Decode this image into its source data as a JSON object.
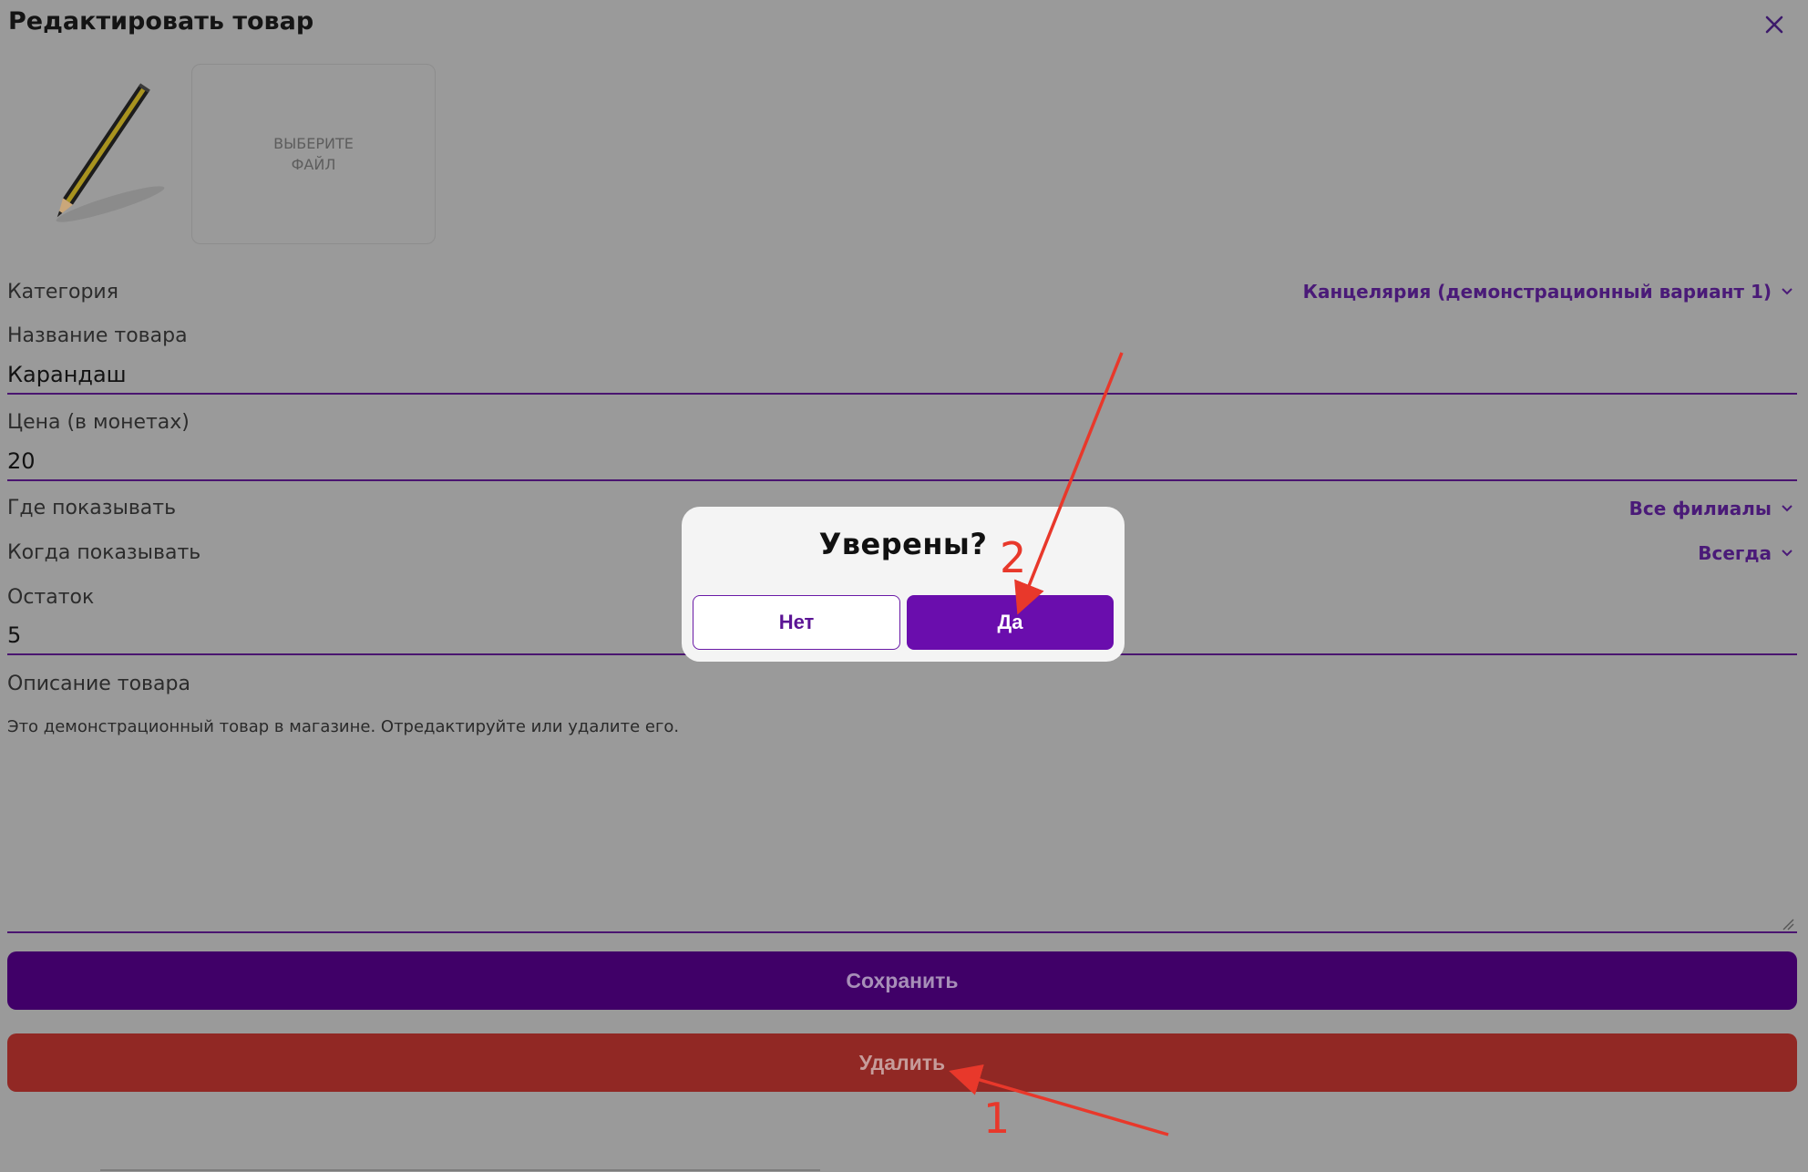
{
  "header": {
    "title": "Редактировать товар"
  },
  "image_upload": {
    "label": "ВЫБЕРИТЕ ФАЙЛ"
  },
  "form": {
    "category": {
      "label": "Категория",
      "value": "Канцелярия (демонстрационный вариант 1)"
    },
    "name": {
      "label": "Название товара",
      "value": "Карандаш"
    },
    "price": {
      "label": "Цена (в монетах)",
      "value": "20"
    },
    "where": {
      "label": "Где показывать",
      "value": "Все филиалы"
    },
    "when": {
      "label": "Когда показывать",
      "value": "Всегда"
    },
    "stock": {
      "label": "Остаток",
      "value": "5"
    },
    "description": {
      "label": "Описание товара",
      "value": "Это демонстрационный товар в магазине. Отредактируйте или удалите его."
    }
  },
  "actions": {
    "save_label": "Сохранить",
    "delete_label": "Удалить"
  },
  "confirm_dialog": {
    "title": "Уверены?",
    "no_label": "Нет",
    "yes_label": "Да"
  },
  "annotations": {
    "step1": "1",
    "step2": "2"
  },
  "colors": {
    "accent": "#6a0dad",
    "save": "#400068",
    "delete": "#912824",
    "arrow": "#e8382b"
  }
}
